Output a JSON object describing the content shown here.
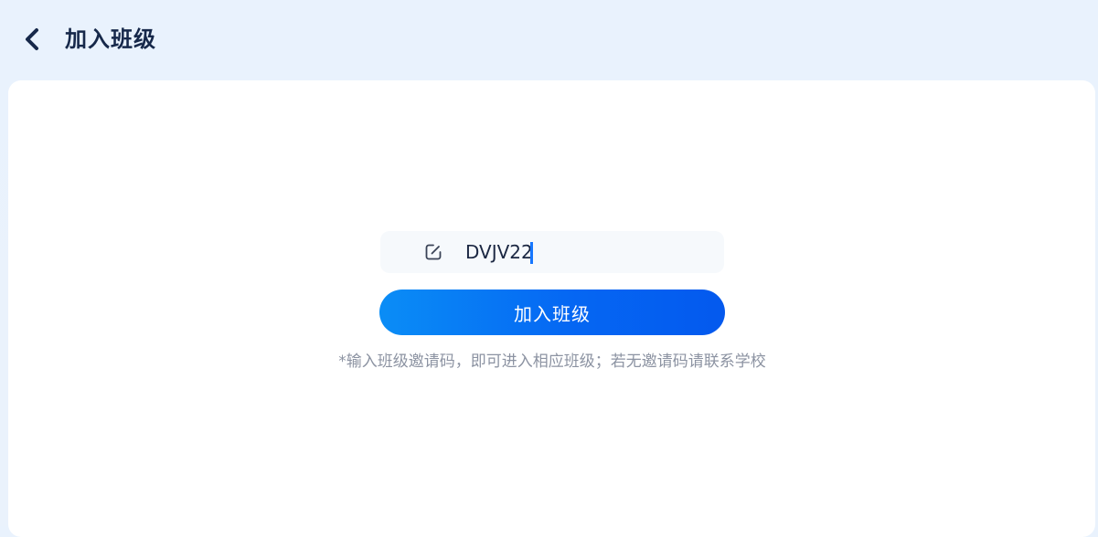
{
  "header": {
    "back_icon": "chevron-left-icon",
    "title": "加入班级"
  },
  "form": {
    "edit_icon": "edit-icon",
    "invite_code_value": "DVJV22",
    "join_button_label": "加入班级",
    "hint": "*输入班级邀请码，即可进入相应班级；若无邀请码请联系学校"
  },
  "colors": {
    "primary": "#0567f3",
    "title": "#16284a",
    "hint": "#8c93a2",
    "page_background": "#e9f2fd"
  }
}
